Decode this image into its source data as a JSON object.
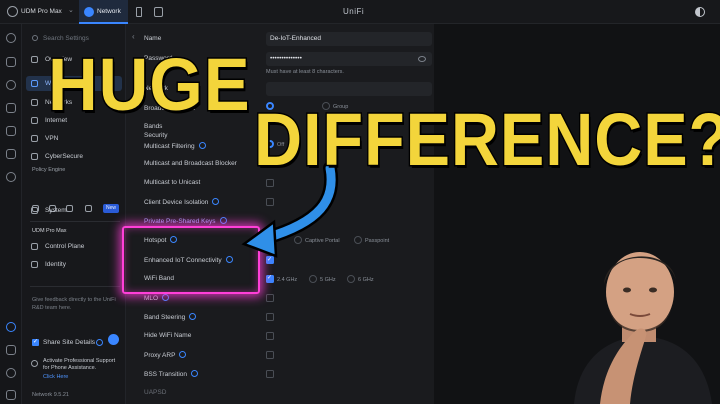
{
  "topbar": {
    "console_name": "UDM Pro Max",
    "app_tab": "Network",
    "brand": "UniFi"
  },
  "sidebar": {
    "search_placeholder": "Search Settings",
    "items": [
      {
        "label": "Overview",
        "icon": "overview-icon"
      },
      {
        "label": "WiFi",
        "icon": "wifi-icon",
        "active": true
      },
      {
        "label": "Networks",
        "icon": "network-icon"
      },
      {
        "label": "Internet",
        "icon": "globe-icon"
      },
      {
        "label": "VPN",
        "icon": "vpn-icon"
      },
      {
        "label": "CyberSecure",
        "icon": "shield-icon"
      }
    ],
    "policy_engine_title": "Policy Engine",
    "policy_engine_badge": "New",
    "system_label": "System",
    "console_section": "UDM Pro Max",
    "console_items": [
      {
        "label": "Control Plane"
      },
      {
        "label": "Identity"
      }
    ],
    "feedback_text": "Give feedback directly to the UniFi R&D team here.",
    "share_label": "Share Site Details",
    "promo_text": "Activate Professional Support for Phone Assistance.",
    "promo_link": "Click Here",
    "version": "Network 9.5.21"
  },
  "form": {
    "name_label": "Name",
    "name_value": "De-IoT-Enhanced",
    "password_label": "Password",
    "password_value": "••••••••••••••",
    "password_hint": "Must have at least 8 characters.",
    "network_label": "Network",
    "broadcasting_label": "Broadcasting APs",
    "bands_label": "Bands",
    "security_label": "Security",
    "multicast_filtering_label": "Multicast Filtering",
    "multicast_broadcast_blocker_label": "Multicast and Broadcast Blocker",
    "multicast_to_unicast_label": "Multicast to Unicast",
    "client_isolation_label": "Client Device Isolation",
    "ppsk_label": "Private Pre-Shared Keys",
    "hotspot_label": "Hotspot",
    "enhanced_iot_label": "Enhanced IoT Connectivity",
    "wifi_band_label": "WiFi Band",
    "mlo_label": "MLO",
    "band_steering_label": "Band Steering",
    "hide_wifi_label": "Hide WiFi Name",
    "proxy_arp_label": "Proxy ARP",
    "bss_transition_label": "BSS Transition",
    "uapsd_label": "UAPSD",
    "group_label": "Group",
    "off_label": "Off",
    "captive_portal_label": "Captive Portal",
    "passpoint_label": "Passpoint",
    "bands": [
      "2.4 GHz",
      "5 GHz",
      "6 GHz"
    ],
    "enhanced_iot_checked": true,
    "band_24_checked": true
  },
  "overlay": {
    "line1": "HUGE DIFFERENCE?",
    "line2": "DIFFERENCE?",
    "line1_short": "HUGE",
    "text_color": "#f3d53b",
    "highlight_color": "#ff3fd8",
    "arrow_color": "#2f8fe8"
  }
}
